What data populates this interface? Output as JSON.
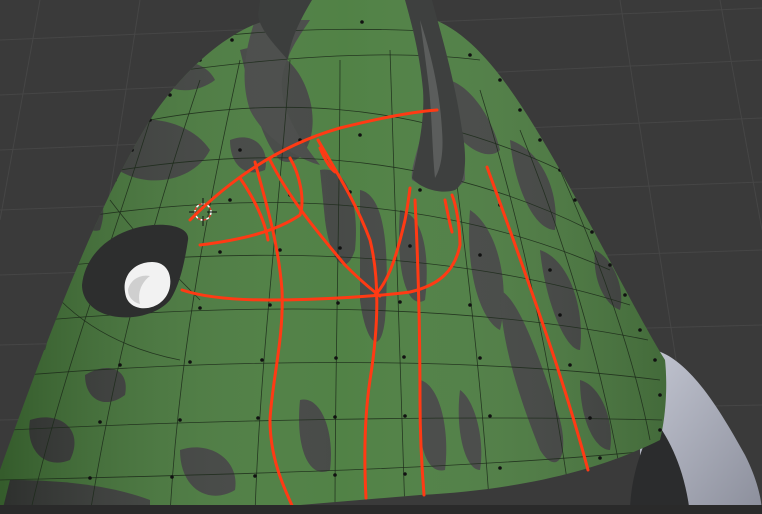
{
  "viewport": {
    "kind": "3d-viewport",
    "colors": {
      "background": "#3a3a3a",
      "grid": "#454545",
      "mesh_green": "#467a3a",
      "mesh_dark": "#3c3f3c",
      "wire": "#1c2a1a",
      "vertex": "#111111",
      "annotation": "#ff3a14",
      "eye_white": "#f2f2f2",
      "side_object": "#a7aab8"
    },
    "icons": {
      "cursor": "3d-cursor-icon"
    },
    "overlay_strokes_count": 12
  }
}
